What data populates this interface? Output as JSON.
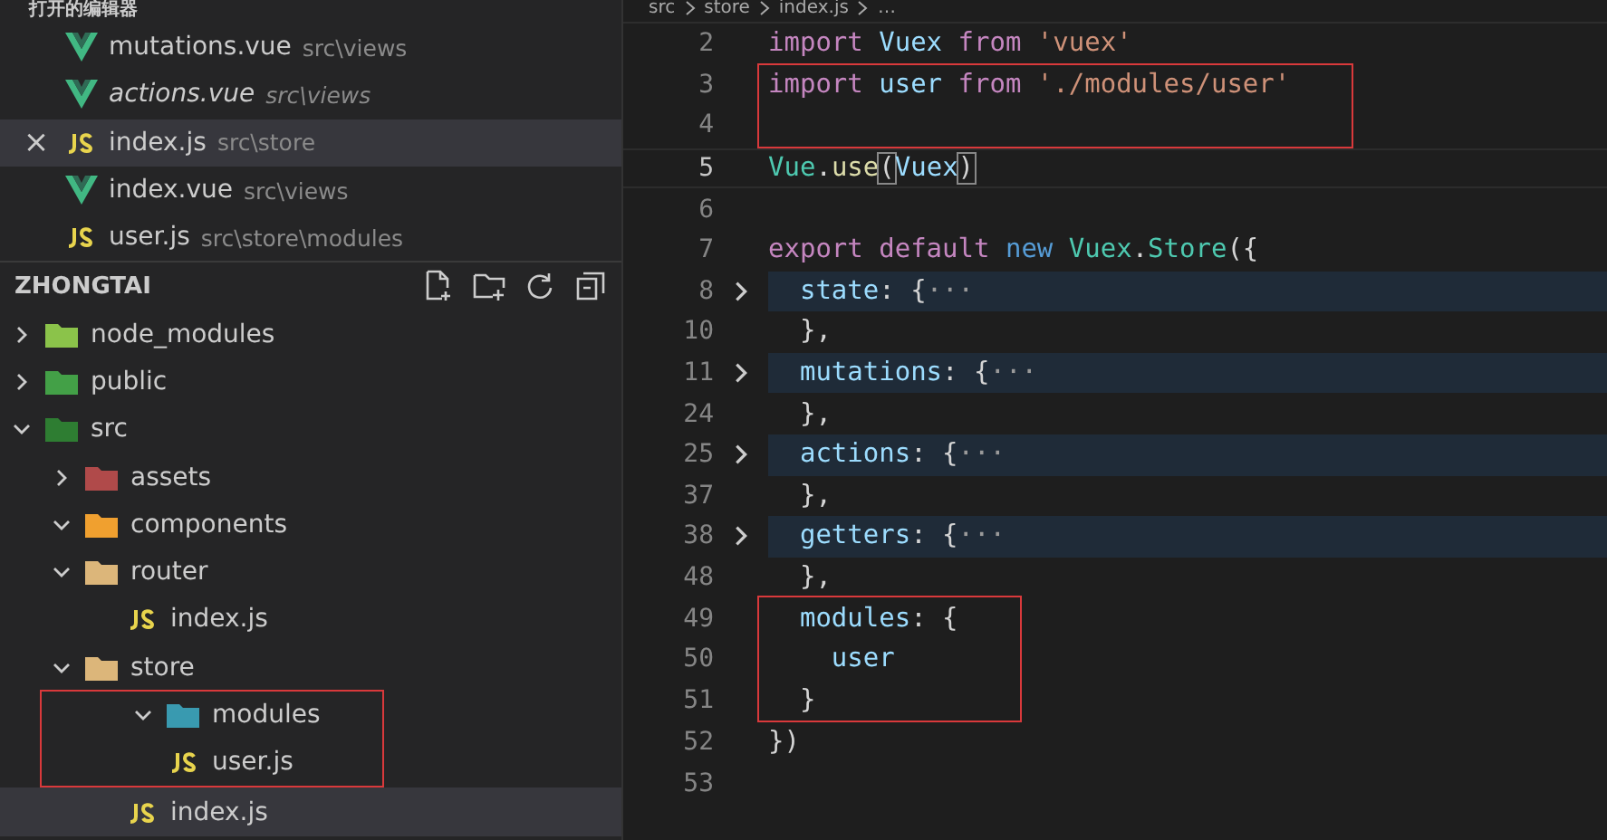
{
  "sidebar": {
    "open_editors": {
      "title": "打开的编辑器",
      "items": [
        {
          "kind": "vue",
          "name": "mutations.vue",
          "path": "src\\views",
          "preview": false,
          "selected": false
        },
        {
          "kind": "vue",
          "name": "actions.vue",
          "path": "src\\views",
          "preview": true,
          "selected": false
        },
        {
          "kind": "js",
          "name": "index.js",
          "path": "src\\store",
          "preview": false,
          "selected": true,
          "close": "×"
        },
        {
          "kind": "vue",
          "name": "index.vue",
          "path": "src\\views",
          "preview": false,
          "selected": false
        },
        {
          "kind": "js",
          "name": "user.js",
          "path": "src\\store\\modules",
          "preview": false,
          "selected": false
        }
      ]
    },
    "explorer": {
      "title": "ZHONGTAI",
      "tree": [
        {
          "kind": "node",
          "name": "node_modules",
          "expanded": false,
          "selected": false,
          "boxed": false
        },
        {
          "kind": "public",
          "name": "public",
          "expanded": false,
          "selected": false,
          "boxed": false
        },
        {
          "kind": "src",
          "name": "src",
          "expanded": true,
          "selected": false,
          "boxed": false,
          "children": [
            {
              "kind": "assets",
              "name": "assets",
              "expanded": false,
              "selected": false,
              "boxed": false
            },
            {
              "kind": "components",
              "name": "components",
              "expanded": true,
              "selected": false,
              "boxed": false
            },
            {
              "kind": "folder",
              "name": "router",
              "expanded": true,
              "selected": false,
              "boxed": false,
              "children": [
                {
                  "kind": "js",
                  "name": "index.js",
                  "selected": false,
                  "boxed": false
                }
              ]
            },
            {
              "kind": "folder",
              "name": "store",
              "expanded": true,
              "selected": false,
              "boxed": false,
              "children": [
                {
                  "kind": "modules",
                  "name": "modules",
                  "expanded": true,
                  "selected": false,
                  "boxed": true,
                  "children": [
                    {
                      "kind": "js",
                      "name": "user.js",
                      "selected": false,
                      "boxed": false
                    }
                  ]
                },
                {
                  "kind": "js",
                  "name": "index.js",
                  "selected": true,
                  "boxed": false
                }
              ]
            }
          ]
        }
      ]
    }
  },
  "editor": {
    "breadcrumb": [
      "src",
      "store",
      "index.js",
      "…"
    ],
    "blocks": [
      {
        "boxed": false,
        "lines": [
          {
            "number": "2",
            "folded": false,
            "current": false,
            "tokens": [
              {
                "kind": "keyword",
                "text": "import"
              },
              {
                "kind": "var",
                "text": " Vuex"
              },
              {
                "kind": "keyword",
                "text": " from"
              },
              {
                "kind": "string",
                "text": " 'vuex'"
              }
            ]
          }
        ]
      },
      {
        "boxed": true,
        "lines": [
          {
            "number": "3",
            "folded": false,
            "current": false,
            "tokens": [
              {
                "kind": "keyword",
                "text": "import"
              },
              {
                "kind": "var",
                "text": " user"
              },
              {
                "kind": "keyword",
                "text": " from"
              },
              {
                "kind": "string",
                "text": " './modules/user'"
              }
            ]
          },
          {
            "number": "4",
            "folded": false,
            "current": false
          }
        ]
      },
      {
        "boxed": false,
        "lines": [
          {
            "number": "5",
            "folded": false,
            "current": true,
            "tokens": [
              {
                "kind": "class",
                "text": "Vue"
              },
              {
                "kind": "punct",
                "text": "."
              },
              {
                "kind": "func",
                "text": "use"
              },
              {
                "kind": "bracket",
                "text": "("
              },
              {
                "kind": "var",
                "text": "Vuex"
              },
              {
                "kind": "bracket",
                "text": ")"
              }
            ]
          },
          {
            "number": "6",
            "folded": false,
            "current": false
          },
          {
            "number": "7",
            "folded": false,
            "current": false,
            "tokens": [
              {
                "kind": "keyword",
                "text": "export"
              },
              {
                "kind": "keyword",
                "text": " default"
              },
              {
                "kind": "storage",
                "text": " new"
              },
              {
                "kind": "class",
                "text": " Vuex"
              },
              {
                "kind": "punct",
                "text": "."
              },
              {
                "kind": "class",
                "text": "Store"
              },
              {
                "kind": "punct",
                "text": "({"
              }
            ]
          },
          {
            "number": "8",
            "folded": true,
            "current": false,
            "tokens": [
              {
                "kind": "var",
                "text": "  state"
              },
              {
                "kind": "punct",
                "text": ": {"
              },
              {
                "kind": "ellipsis",
                "text": "···"
              }
            ]
          },
          {
            "number": "10",
            "folded": false,
            "current": false,
            "tokens": [
              {
                "kind": "punct",
                "text": "  },"
              }
            ]
          },
          {
            "number": "11",
            "folded": true,
            "current": false,
            "tokens": [
              {
                "kind": "var",
                "text": "  mutations"
              },
              {
                "kind": "punct",
                "text": ": {"
              },
              {
                "kind": "ellipsis",
                "text": "···"
              }
            ]
          },
          {
            "number": "24",
            "folded": false,
            "current": false,
            "tokens": [
              {
                "kind": "punct",
                "text": "  },"
              }
            ]
          },
          {
            "number": "25",
            "folded": true,
            "current": false,
            "tokens": [
              {
                "kind": "var",
                "text": "  actions"
              },
              {
                "kind": "punct",
                "text": ": {"
              },
              {
                "kind": "ellipsis",
                "text": "···"
              }
            ]
          },
          {
            "number": "37",
            "folded": false,
            "current": false,
            "tokens": [
              {
                "kind": "punct",
                "text": "  },"
              }
            ]
          },
          {
            "number": "38",
            "folded": true,
            "current": false,
            "tokens": [
              {
                "kind": "var",
                "text": "  getters"
              },
              {
                "kind": "punct",
                "text": ": {"
              },
              {
                "kind": "ellipsis",
                "text": "···"
              }
            ]
          },
          {
            "number": "48",
            "folded": false,
            "current": false,
            "tokens": [
              {
                "kind": "punct",
                "text": "  },"
              }
            ]
          }
        ]
      },
      {
        "boxed": true,
        "lines": [
          {
            "number": "49",
            "folded": false,
            "current": false,
            "tokens": [
              {
                "kind": "var",
                "text": "  modules"
              },
              {
                "kind": "punct",
                "text": ": {"
              }
            ]
          },
          {
            "number": "50",
            "folded": false,
            "current": false,
            "tokens": [
              {
                "kind": "var",
                "text": "    user"
              }
            ]
          },
          {
            "number": "51",
            "folded": false,
            "current": false,
            "tokens": [
              {
                "kind": "punct",
                "text": "  }"
              }
            ]
          }
        ]
      },
      {
        "boxed": false,
        "lines": [
          {
            "number": "52",
            "folded": false,
            "current": false,
            "tokens": [
              {
                "kind": "punct",
                "text": "})"
              }
            ]
          },
          {
            "number": "53",
            "folded": false,
            "current": false
          }
        ]
      }
    ]
  }
}
